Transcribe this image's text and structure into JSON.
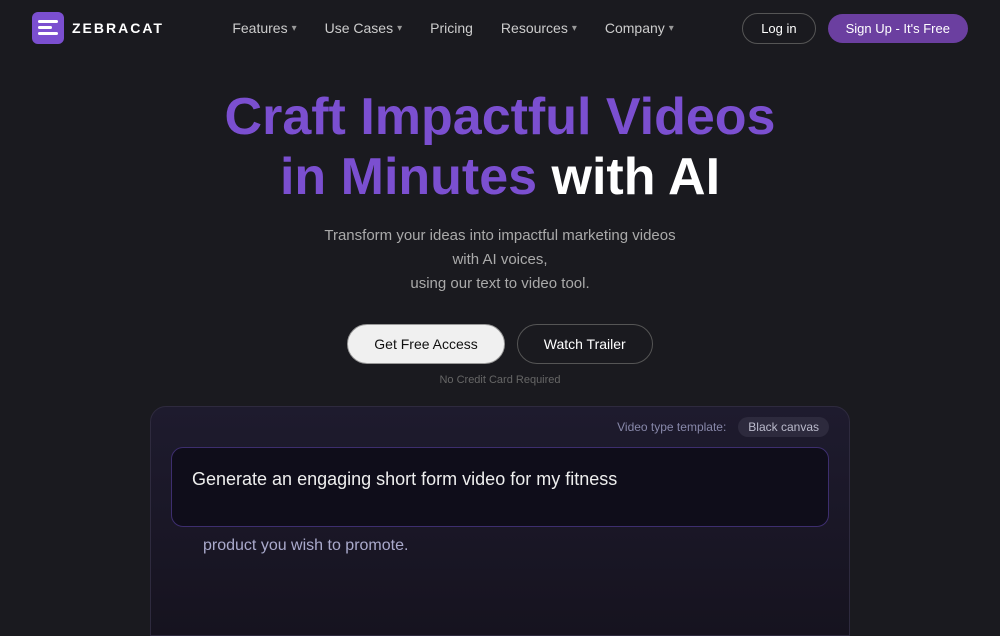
{
  "navbar": {
    "logo_text": "ZEBRACAT",
    "nav_items": [
      {
        "label": "Features",
        "has_dropdown": true
      },
      {
        "label": "Use Cases",
        "has_dropdown": true
      },
      {
        "label": "Pricing",
        "has_dropdown": false
      },
      {
        "label": "Resources",
        "has_dropdown": true
      },
      {
        "label": "Company",
        "has_dropdown": true
      }
    ],
    "btn_login": "Log in",
    "btn_signup": "Sign Up - It's Free"
  },
  "hero": {
    "title_line1_purple": "Craft Impactful Videos",
    "title_line2_start": "in Minutes ",
    "title_line2_end": "with AI",
    "subtitle_line1": "Transform your ideas into impactful marketing videos with AI voices,",
    "subtitle_line2": "using our text to video tool.",
    "btn_primary": "Get Free Access",
    "btn_secondary": "Watch Trailer",
    "no_cc_text": "No Credit Card Required"
  },
  "demo": {
    "label": "Video type template:",
    "tag": "Black canvas",
    "prompt": "Generate an engaging short form video for my fitness",
    "product_label": "product you wish to promote."
  },
  "colors": {
    "bg": "#1a1a1f",
    "purple": "#7b4fd0",
    "btn_signup_bg": "#6b3fa0"
  }
}
